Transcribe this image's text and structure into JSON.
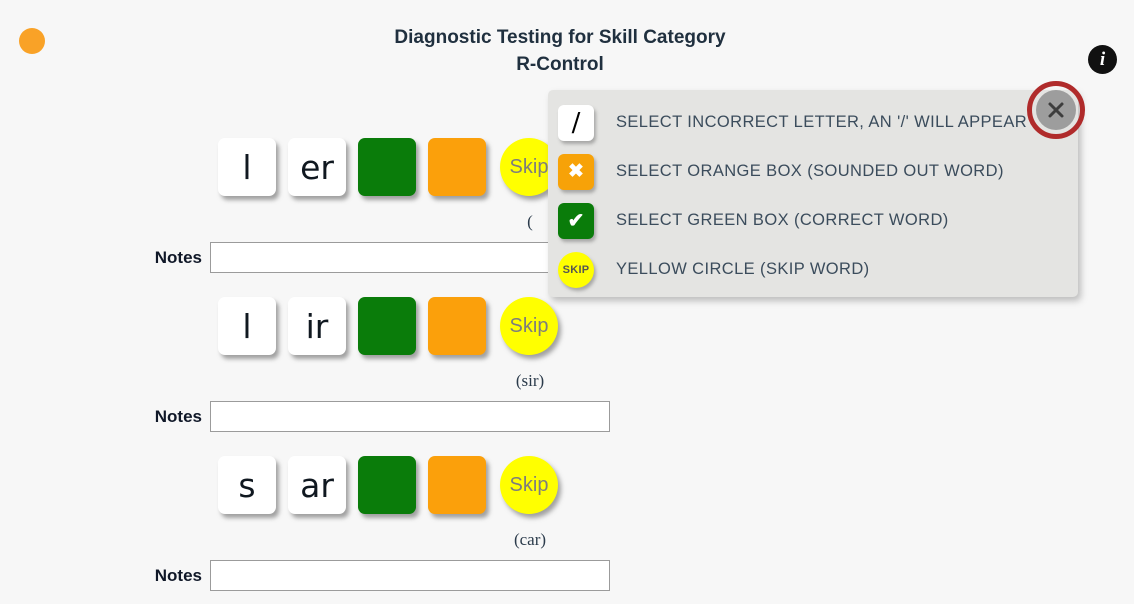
{
  "header": {
    "title_line1": "Diagnostic Testing for Skill Category",
    "title_line2": "R-Control",
    "status_dot_color": "#f9a227",
    "info_icon": "info-icon",
    "info_glyph": "i"
  },
  "colors": {
    "background": "#f7f7f7",
    "green_box": "#0a7c0a",
    "orange_box": "#fba00b",
    "skip_yellow": "#ffff00",
    "popup_background": "#e4e4e2",
    "highlight_ring": "#b02b2b",
    "close_button": "#9d9d9d",
    "text_dark": "#20303f",
    "legend_text": "#3b4c5c"
  },
  "words": [
    {
      "tiles": [
        "l",
        "er"
      ],
      "label": "(",
      "skip_label": "Skip",
      "notes_label": "Notes",
      "notes_value": "",
      "notes_placeholder": ""
    },
    {
      "tiles": [
        "l",
        "ir"
      ],
      "label": "(sir)",
      "skip_label": "Skip",
      "notes_label": "Notes",
      "notes_value": "",
      "notes_placeholder": ""
    },
    {
      "tiles": [
        "s",
        "ar"
      ],
      "label": "(car)",
      "skip_label": "Skip",
      "notes_label": "Notes",
      "notes_value": "",
      "notes_placeholder": ""
    }
  ],
  "legend": {
    "rows": [
      {
        "icon": "slash-tile-icon",
        "glyph": "/",
        "text": "SELECT INCORRECT LETTER, AN '/' WILL APPEAR"
      },
      {
        "icon": "orange-x-icon",
        "glyph": "✖",
        "text": "SELECT ORANGE BOX (SOUNDED OUT WORD)"
      },
      {
        "icon": "green-check-icon",
        "glyph": "✔",
        "text": "SELECT GREEN BOX (CORRECT WORD)"
      },
      {
        "icon": "skip-circle-icon",
        "glyph": "SKIP",
        "text": "YELLOW CIRCLE (SKIP WORD)"
      }
    ],
    "close_label": "close-icon"
  }
}
